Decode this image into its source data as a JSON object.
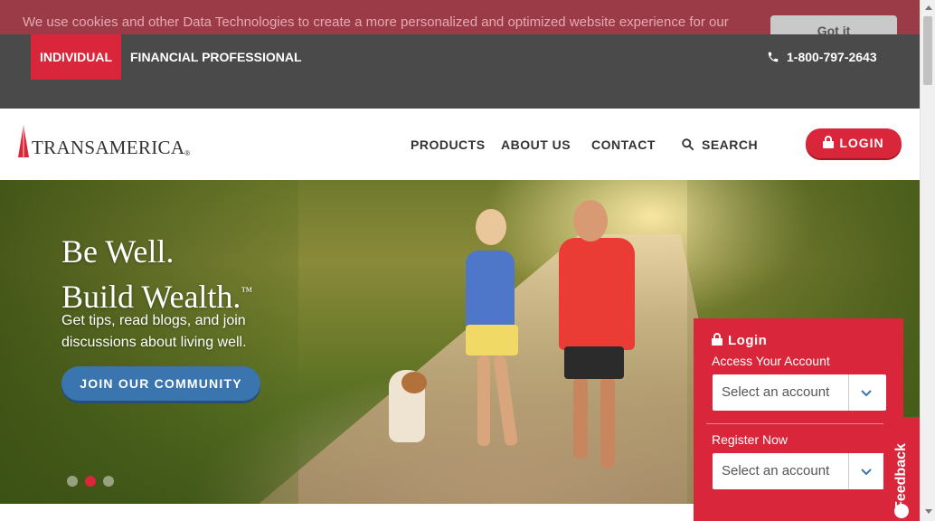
{
  "cookie_banner": {
    "text": "We use cookies and other Data Technologies to create a more personalized and optimized website experience for our",
    "button_label": "Got it"
  },
  "topbar": {
    "tabs": [
      {
        "label": "INDIVIDUAL",
        "active": true
      },
      {
        "label": "FINANCIAL PROFESSIONAL",
        "active": false
      }
    ],
    "phone": "1-800-797-2643"
  },
  "header": {
    "logo_text": "TRANSAMERICA",
    "nav": {
      "products": "PRODUCTS",
      "about": "ABOUT US",
      "contact": "CONTACT",
      "search": "SEARCH"
    },
    "login_label": "LOGIN",
    "brand_color": "#d9263a"
  },
  "hero": {
    "headline_line1": "Be Well.",
    "headline_line2": "Build Wealth.",
    "headline_mark": "™",
    "subcopy": "Get tips, read blogs, and join discussions about living well.",
    "cta_label": "JOIN OUR COMMUNITY",
    "carousel": {
      "total_slides": 3,
      "active_slide": 2
    }
  },
  "login_panel": {
    "title": "Login",
    "access_label": "Access Your Account",
    "access_select": "Select an account",
    "register_label": "Register Now",
    "register_select": "Select an account"
  },
  "feedback": {
    "label": "Feedback"
  },
  "icons": [
    "phone-icon",
    "search-icon",
    "lock-icon",
    "chevron-down-icon",
    "feedback-icon",
    "logo-tower-icon"
  ]
}
